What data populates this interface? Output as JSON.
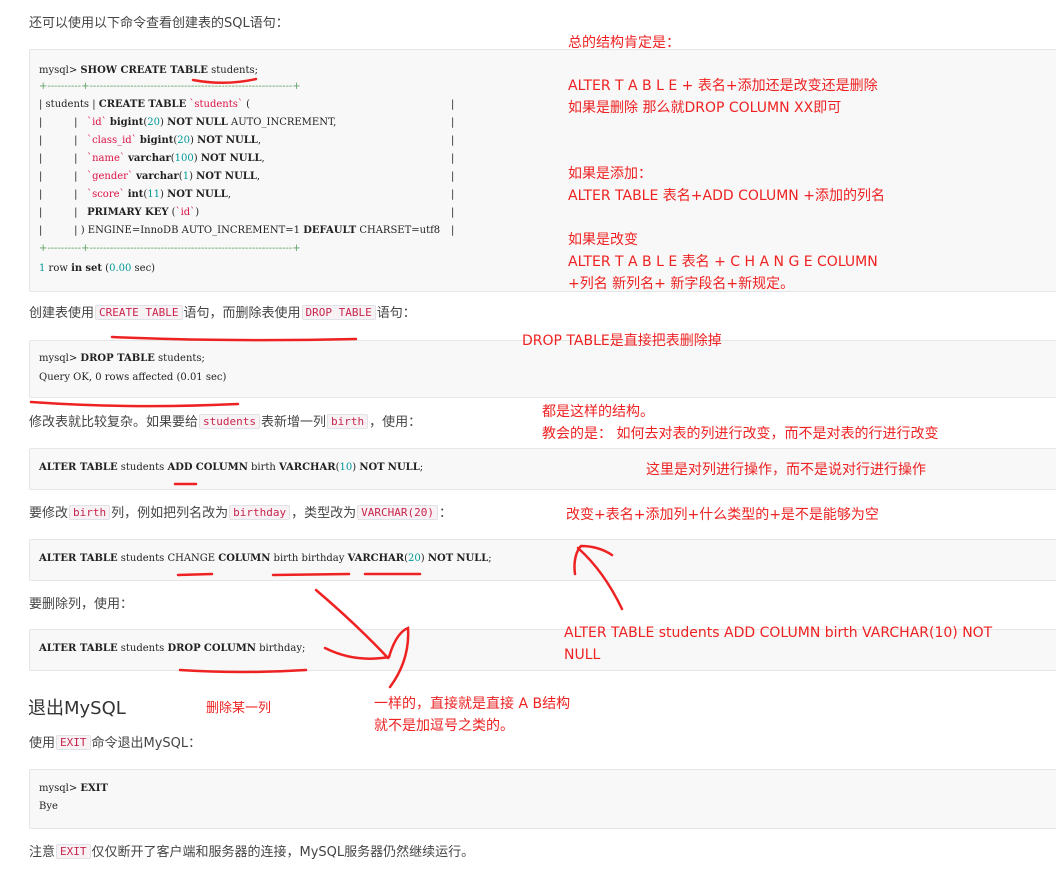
{
  "intro_text": "还可以使用以下命令查看创建表的SQL语句：",
  "show_create": {
    "prompt": "mysql> ",
    "cmd": "SHOW CREATE TABLE",
    "table": " students;",
    "border_top": "+----------+------------------------------------------------------------+",
    "border_bottom": "+----------+------------------------------------------------------------+",
    "rows": [
      {
        "col1": "| students ",
        "body": "| CREATE TABLE `students` (",
        "end": "|"
      },
      {
        "col1": "|          ",
        "body": "|   `id` bigint(20) NOT NULL AUTO_INCREMENT,",
        "end": "|"
      },
      {
        "col1": "|          ",
        "body": "|   `class_id` bigint(20) NOT NULL,",
        "end": "|"
      },
      {
        "col1": "|          ",
        "body": "|   `name` varchar(100) NOT NULL,",
        "end": "|"
      },
      {
        "col1": "|          ",
        "body": "|   `gender` varchar(1) NOT NULL,",
        "end": "|"
      },
      {
        "col1": "|          ",
        "body": "|   `score` int(11) NOT NULL,",
        "end": "|"
      },
      {
        "col1": "|          ",
        "body": "|   PRIMARY KEY (`id`)",
        "end": "|"
      },
      {
        "col1": "|          ",
        "body": "| ) ENGINE=InnoDB AUTO_INCREMENT=1 DEFAULT CHARSET=utf8",
        "end": "|"
      }
    ],
    "result": "1 row in set (0.00 sec)"
  },
  "drop_text": {
    "pre": "创建表使用",
    "code1": "CREATE TABLE",
    "mid": "语句，而删除表使用",
    "code2": "DROP TABLE",
    "post": "语句："
  },
  "drop_block": {
    "line1": "mysql> DROP TABLE students;",
    "line2": "Query OK, 0 rows affected (0.01 sec)"
  },
  "modify_text": {
    "pre": "修改表就比较复杂。如果要给",
    "code1": "students",
    "mid": "表新增一列",
    "code2": "birth",
    "post": "，使用："
  },
  "add_col": "ALTER TABLE students ADD COLUMN birth VARCHAR(10) NOT NULL;",
  "change_text": {
    "pre": "要修改",
    "code1": "birth",
    "mid1": "列，例如把列名改为",
    "code2": "birthday",
    "mid2": "，类型改为",
    "code3": "VARCHAR(20)",
    "post": "："
  },
  "change_col": "ALTER TABLE students CHANGE COLUMN birth birthday VARCHAR(20) NOT NULL;",
  "delete_text": "要删除列，使用：",
  "drop_col": "ALTER TABLE students DROP COLUMN birthday;",
  "exit_heading": "退出MySQL",
  "exit_text": {
    "pre": "使用",
    "code": "EXIT",
    "post": "命令退出MySQL："
  },
  "exit_block": {
    "line1": "mysql> EXIT",
    "line2": "Bye"
  },
  "note_text": {
    "pre": "注意",
    "code": "EXIT",
    "post": "仅仅断开了客户端和服务器的连接，MySQL服务器仍然继续运行。"
  },
  "annotations": {
    "a1": "总的结构肯定是：",
    "a2": "ALTER  T A B L E        + 表名+添加还是改变还是删除",
    "a3": "如果是删除 那么就DROP COLUMN XX即可",
    "a4": "如果是添加：",
    "a5": "ALTER TABLE 表名+ADD COLUMN  +添加的列名",
    "a6": "如果是改变",
    "a7": "ALTER  T A B L E     表名 +      C H A N G E  COLUMN",
    "a8": "+列名   新列名+ 新字段名+新规定。",
    "a9": "DROP TABLE是直接把表删除掉",
    "a10": "都是这样的结构。",
    "a11": "教会的是：  如何去对表的列进行改变，而不是对表的行进行改变",
    "a12": "这里是对列进行操作，而不是说对行进行操作",
    "a13": "改变+表名+添加列+什么类型的+是不是能够为空",
    "a14": "ALTER TABLE students ADD COLUMN birth VARCHAR(10) NOT",
    "a15": "NULL",
    "a16": "删除某一列",
    "a17": "一样的，直接就是直接  A B结构",
    "a18": "就不是加逗号之类的。"
  },
  "colors": {
    "annotation": "#ee2222",
    "code_inline": "#c7254e",
    "number": "#009999",
    "string": "#dd1144"
  }
}
